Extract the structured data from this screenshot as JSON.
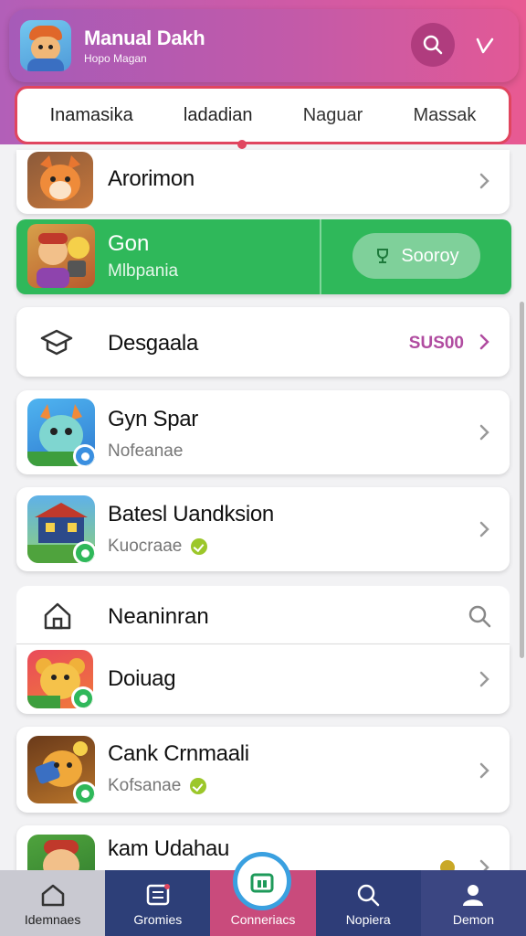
{
  "header": {
    "title": "Manual Dakh",
    "subtitle": "Hopo Magan",
    "logo_icon": "fox-character-logo-icon",
    "search_icon": "search-icon",
    "check_icon": "check-icon"
  },
  "tabs": [
    {
      "label": "Inamasika"
    },
    {
      "label": "ladadian"
    },
    {
      "label": "Naguar"
    },
    {
      "label": "Massak"
    }
  ],
  "items": {
    "first": {
      "name": "Arorimon"
    },
    "green": {
      "name": "Gon",
      "sub": "Mlbpania",
      "button": "Sooroy"
    },
    "deals": {
      "name": "Desgaala",
      "price": "SUS00"
    },
    "gyn": {
      "name": "Gyn Spar",
      "sub": "Nofeanae"
    },
    "bates": {
      "name": "Batesl Uandksion",
      "sub": "Kuocraae"
    },
    "section": {
      "name": "Neaninran"
    },
    "doiuag": {
      "name": "Doiuag"
    },
    "cank": {
      "name": "Cank Crnmaali",
      "sub": "Kofsanae"
    },
    "kam": {
      "name": "kam Udahau"
    }
  },
  "bottom_nav": [
    {
      "label": "Idemnaes",
      "icon": "home-icon"
    },
    {
      "label": "Gromies",
      "icon": "list-icon"
    },
    {
      "label": "Conneriacs",
      "icon": "store-icon"
    },
    {
      "label": "Nopiera",
      "icon": "search-icon"
    },
    {
      "label": "Demon",
      "icon": "user-icon"
    }
  ],
  "colors": {
    "header_start": "#a65bb8",
    "header_end": "#e25996",
    "tab_border": "#e0455f",
    "green_card": "#2fb85a",
    "price": "#b04ca0",
    "nav_bg": "#2c3e76",
    "nav_active": "#c94b7c"
  }
}
